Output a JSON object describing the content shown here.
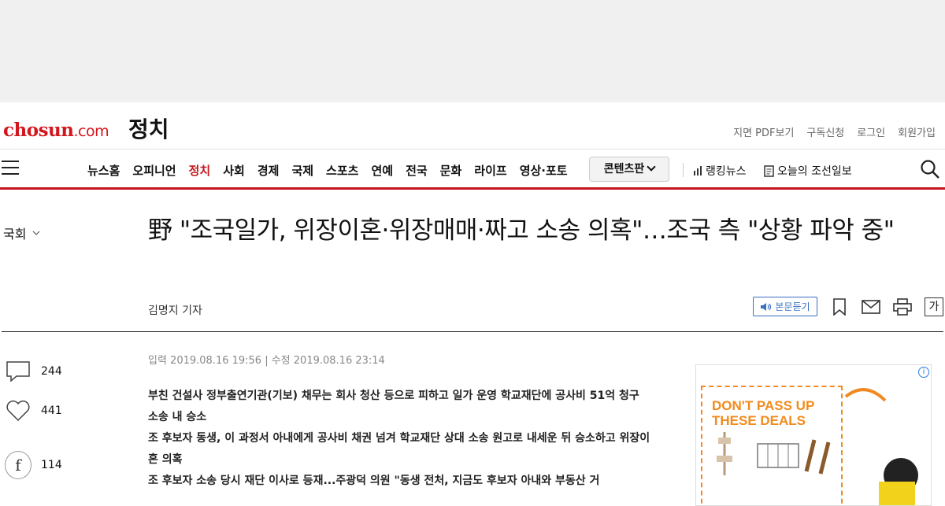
{
  "header": {
    "logo_main": "chosun",
    "logo_suffix": ".com",
    "section": "정치",
    "utility_links": [
      "지면 PDF보기",
      "구독신청",
      "로그인",
      "회원가입"
    ]
  },
  "nav": {
    "items": [
      "뉴스홈",
      "오피니언",
      "정치",
      "사회",
      "경제",
      "국제",
      "스포츠",
      "연예",
      "전국",
      "문화",
      "라이프",
      "영상·포토"
    ],
    "active": "정치",
    "content_button": "콘텐츠판",
    "ranking": "랭킹뉴스",
    "today": "오늘의 조선일보"
  },
  "article": {
    "category": "국회",
    "headline": "野 \"조국일가, 위장이혼·위장매매·짜고 소송 의혹\"…조국 측 \"상황 파악 중\"",
    "byline": "김명지 기자",
    "listen_label": "본문듣기",
    "fontsize_label": "가",
    "dates": "입력 2019.08.16 19:56 | 수정 2019.08.16 23:14",
    "summary": [
      "부친 건설사 정부출연기관(기보) 채무는 회사 청산 등으로 피하고 일가 운영 학교재단에 공사비 51억 청구 소송 내 승소",
      "조 후보자 동생, 이 과정서 아내에게 공사비 채권 넘겨 학교재단 상대 소송 원고로 내세운 뒤 승소하고 위장이혼 의혹",
      "조 후보자 소송 당시 재단 이사로 등재...주광덕 의원 \"동생 전처, 지금도 후보자 아내와 부동산 거"
    ]
  },
  "sidebar": {
    "comments": "244",
    "likes": "441",
    "facebook": "114"
  },
  "ad": {
    "headline_1": "DON'T PASS UP",
    "headline_2": "THESE DEALS",
    "info": "i"
  },
  "colors": {
    "brand_red": "#c4161c",
    "listen_blue": "#3a6fc0",
    "ad_orange": "#f28b1d"
  }
}
